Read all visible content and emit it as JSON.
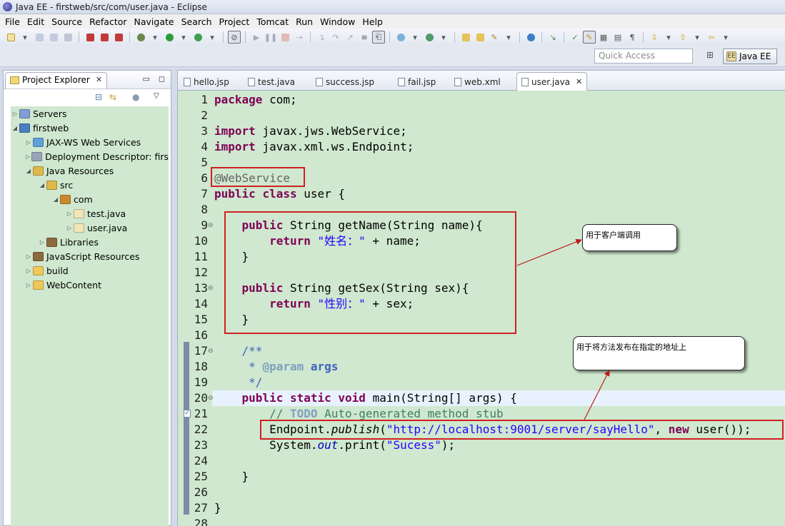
{
  "window": {
    "title": "Java EE - firstweb/src/com/user.java - Eclipse"
  },
  "menu": [
    "File",
    "Edit",
    "Source",
    "Refactor",
    "Navigate",
    "Search",
    "Project",
    "Tomcat",
    "Run",
    "Window",
    "Help"
  ],
  "quick_access": {
    "placeholder": "Quick Access"
  },
  "perspective": {
    "label": "Java EE"
  },
  "explorer": {
    "title": "Project Explorer",
    "items": [
      {
        "label": "Servers",
        "indent": 0,
        "arrow": "▷",
        "icon_color": "#7f9ed6"
      },
      {
        "label": "firstweb",
        "indent": 0,
        "arrow": "◢",
        "icon_color": "#4a7fc1"
      },
      {
        "label": "JAX-WS Web Services",
        "indent": 1,
        "arrow": "▷",
        "icon_color": "#5fa0d8"
      },
      {
        "label": "Deployment Descriptor: firs",
        "indent": 1,
        "arrow": "▷",
        "icon_color": "#9aa4b8"
      },
      {
        "label": "Java Resources",
        "indent": 1,
        "arrow": "◢",
        "icon_color": "#e1b84a"
      },
      {
        "label": "src",
        "indent": 2,
        "arrow": "◢",
        "icon_color": "#e1b84a"
      },
      {
        "label": "com",
        "indent": 3,
        "arrow": "◢",
        "icon_color": "#c98a2e"
      },
      {
        "label": "test.java",
        "indent": 4,
        "arrow": "▷",
        "icon_color": "#f2e6b8"
      },
      {
        "label": "user.java",
        "indent": 4,
        "arrow": "▷",
        "icon_color": "#f2e6b8"
      },
      {
        "label": "Libraries",
        "indent": 2,
        "arrow": "▷",
        "icon_color": "#8b6a3e"
      },
      {
        "label": "JavaScript Resources",
        "indent": 1,
        "arrow": "▷",
        "icon_color": "#8b6a3e"
      },
      {
        "label": "build",
        "indent": 1,
        "arrow": "▷",
        "icon_color": "#f0c85a"
      },
      {
        "label": "WebContent",
        "indent": 1,
        "arrow": "▷",
        "icon_color": "#f0c85a"
      }
    ]
  },
  "editor_tabs": [
    {
      "label": "hello.jsp",
      "active": false
    },
    {
      "label": "test.java",
      "active": false
    },
    {
      "label": "success.jsp",
      "active": false
    },
    {
      "label": "fail.jsp",
      "active": false
    },
    {
      "label": "web.xml",
      "active": false
    },
    {
      "label": "user.java",
      "active": true
    }
  ],
  "code_lines": [
    {
      "n": "1",
      "html": "<span class=\"kw\">package</span> com;"
    },
    {
      "n": "2",
      "html": ""
    },
    {
      "n": "3",
      "html": "<span class=\"kw\">import</span> javax.jws.WebService;"
    },
    {
      "n": "4",
      "html": "<span class=\"kw\">import</span> javax.xml.ws.Endpoint;"
    },
    {
      "n": "5",
      "html": ""
    },
    {
      "n": "6",
      "html": "<span class=\"anno\">@WebService</span>"
    },
    {
      "n": "7",
      "html": "<span class=\"kw\">public</span> <span class=\"kw\">class</span> user {"
    },
    {
      "n": "8",
      "html": ""
    },
    {
      "n": "9",
      "html": "    <span class=\"kw\">public</span> String getName(String name){",
      "fold": "⊖"
    },
    {
      "n": "10",
      "html": "        <span class=\"kw\">return</span> <span class=\"str\">\"姓名：\"</span> + name;"
    },
    {
      "n": "11",
      "html": "    }"
    },
    {
      "n": "12",
      "html": ""
    },
    {
      "n": "13",
      "html": "    <span class=\"kw\">public</span> String getSex(String sex){",
      "fold": "⊖"
    },
    {
      "n": "14",
      "html": "        <span class=\"kw\">return</span> <span class=\"str\">\"性别：\"</span> + sex;"
    },
    {
      "n": "15",
      "html": "    }"
    },
    {
      "n": "16",
      "html": ""
    },
    {
      "n": "17",
      "html": "    <span class=\"cmt\">/**</span>",
      "fold": "⊖"
    },
    {
      "n": "18",
      "html": "     <span class=\"cmt\">* </span><span class=\"task\" style=\"color:#7f9fbf\">@param</span> <span class=\"cmt\" style=\"font-weight:bold\">args</span>"
    },
    {
      "n": "19",
      "html": "     <span class=\"cmt\">*/</span>"
    },
    {
      "n": "20",
      "html": "    <span class=\"kw\">public</span> <span class=\"kw\">static</span> <span class=\"kw\">void</span> main(String[] args) {",
      "fold": "⊖",
      "current": true
    },
    {
      "n": "21",
      "html": "        <span style=\"color:#3f7f5f\">// </span><span class=\"task\">TODO</span><span style=\"color:#3f7f5f\"> Auto-generated method stub</span>",
      "task": true
    },
    {
      "n": "22",
      "html": "        Endpoint.<span class=\"ital\">publish</span>(<span class=\"str\">\"http://localhost:9001/server/sayHello\"</span>, <span class=\"kw\">new</span> user());"
    },
    {
      "n": "23",
      "html": "        System.<span class=\"fieldital\">out</span>.print(<span class=\"str\">\"Sucess\"</span>);"
    },
    {
      "n": "24",
      "html": ""
    },
    {
      "n": "25",
      "html": "    }"
    },
    {
      "n": "26",
      "html": ""
    },
    {
      "n": "27",
      "html": "}"
    },
    {
      "n": "28",
      "html": ""
    }
  ],
  "annotations": {
    "client_callout": "用于客户端调用",
    "publish_callout": "用于将方法发布在指定的地址上"
  },
  "colors": {
    "editor_bg": "#cfe8cf",
    "highlight_red": "#d02020",
    "keyword": "#7f0055",
    "string": "#2a00ff"
  }
}
